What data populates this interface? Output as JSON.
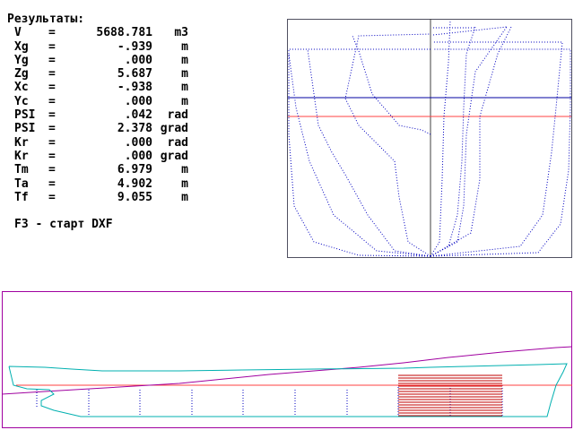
{
  "results": {
    "title": "Результаты:",
    "rows": [
      {
        "label": "V",
        "eq": "=",
        "value": "5688.781",
        "unit": "m3"
      },
      {
        "label": "Xg",
        "eq": "=",
        "value": "-.939",
        "unit": "m"
      },
      {
        "label": "Yg",
        "eq": "=",
        "value": ".000",
        "unit": "m"
      },
      {
        "label": "Zg",
        "eq": "=",
        "value": "5.687",
        "unit": "m"
      },
      {
        "label": "Xc",
        "eq": "=",
        "value": "-.938",
        "unit": "m"
      },
      {
        "label": "Yc",
        "eq": "=",
        "value": ".000",
        "unit": "m"
      },
      {
        "label": "PSI",
        "eq": "=",
        "value": ".042",
        "unit": "rad"
      },
      {
        "label": "PSI",
        "eq": "=",
        "value": "2.378",
        "unit": "grad"
      },
      {
        "label": "Kr",
        "eq": "=",
        "value": ".000",
        "unit": "rad"
      },
      {
        "label": "Kr",
        "eq": "=",
        "value": ".000",
        "unit": "grad"
      },
      {
        "label": "Tm",
        "eq": "=",
        "value": "6.979",
        "unit": "m"
      },
      {
        "label": "Ta",
        "eq": "=",
        "value": "4.902",
        "unit": "m"
      },
      {
        "label": "Tf",
        "eq": "=",
        "value": "9.055",
        "unit": "m"
      }
    ],
    "hint": "F3 - старт DXF"
  },
  "colors": {
    "frame_lines": "#0000c0",
    "waterline": "#ff4040",
    "trim_line": "#a000a0",
    "hull": "#00b0b0",
    "hatch": "#c00000",
    "panel_border": "#a000a0",
    "box_border": "#505060"
  }
}
